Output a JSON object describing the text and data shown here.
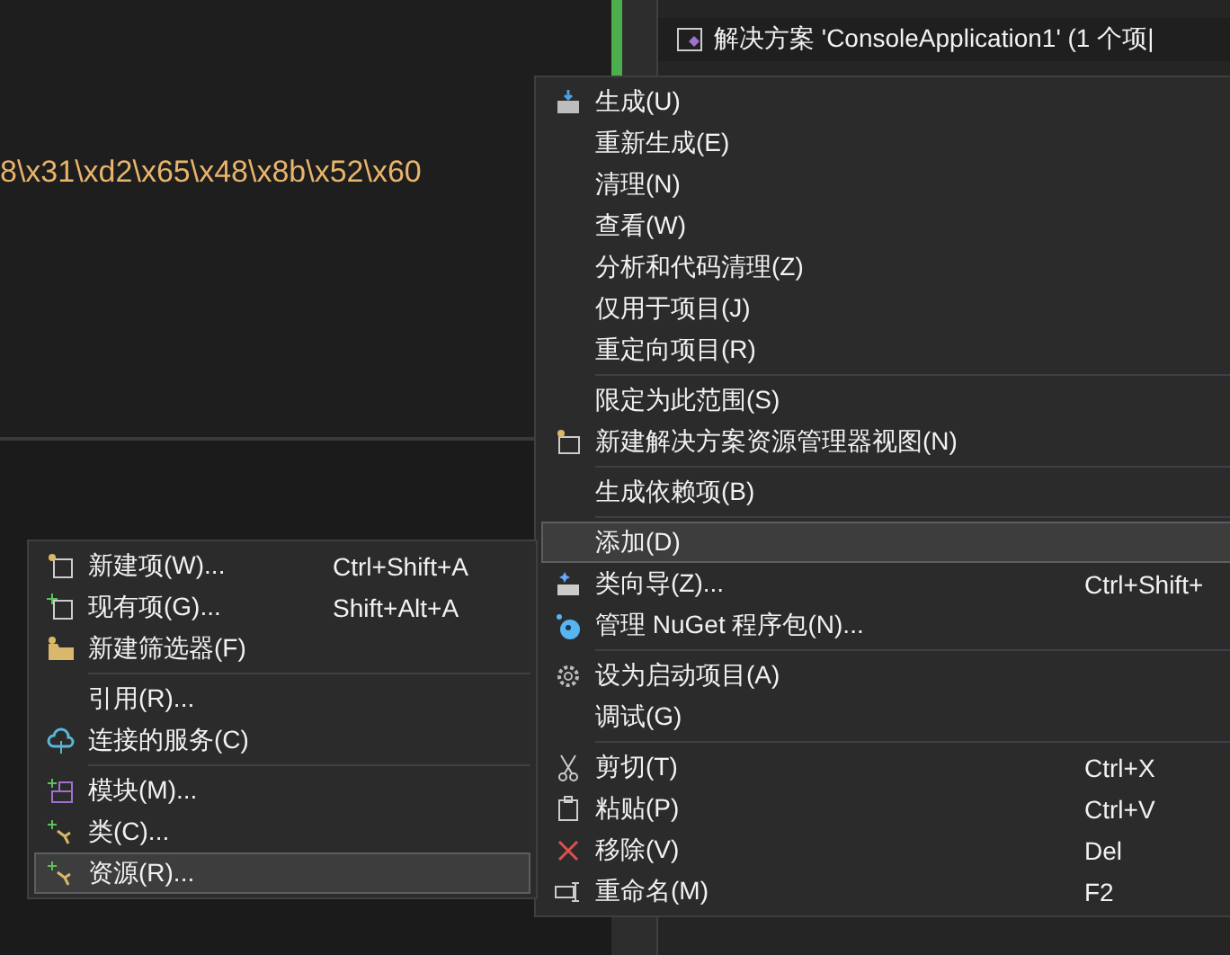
{
  "editor": {
    "code_line": "8\\x31\\xd2\\x65\\x48\\x8b\\x52\\x60"
  },
  "solution_explorer": {
    "solution_row": "解决方案 'ConsoleApplication1' (1 个项|"
  },
  "context_menu": {
    "items": [
      {
        "kind": "item",
        "label": "生成(U)",
        "selected": false
      },
      {
        "kind": "item",
        "label": "重新生成(E)",
        "selected": false
      },
      {
        "kind": "item",
        "label": "清理(N)",
        "selected": false
      },
      {
        "kind": "item",
        "label": "查看(W)",
        "selected": false
      },
      {
        "kind": "item",
        "label": "分析和代码清理(Z)",
        "selected": false
      },
      {
        "kind": "item",
        "label": "仅用于项目(J)",
        "selected": false
      },
      {
        "kind": "item",
        "label": "重定向项目(R)",
        "selected": false
      },
      {
        "kind": "separator"
      },
      {
        "kind": "item",
        "label": "限定为此范围(S)",
        "selected": false
      },
      {
        "kind": "item",
        "label": "新建解决方案资源管理器视图(N)",
        "selected": false
      },
      {
        "kind": "separator"
      },
      {
        "kind": "item",
        "label": "生成依赖项(B)",
        "selected": false
      },
      {
        "kind": "separator"
      },
      {
        "kind": "item",
        "label": "添加(D)",
        "selected": true
      },
      {
        "kind": "item",
        "label": "类向导(Z)...",
        "shortcut": "Ctrl+Shift+",
        "selected": false
      },
      {
        "kind": "item",
        "label": "管理 NuGet 程序包(N)...",
        "selected": false
      },
      {
        "kind": "separator"
      },
      {
        "kind": "item",
        "label": "设为启动项目(A)",
        "selected": false
      },
      {
        "kind": "item",
        "label": "调试(G)",
        "selected": false
      },
      {
        "kind": "separator"
      },
      {
        "kind": "item",
        "label": "剪切(T)",
        "shortcut": "Ctrl+X",
        "selected": false
      },
      {
        "kind": "item",
        "label": "粘贴(P)",
        "shortcut": "Ctrl+V",
        "selected": false
      },
      {
        "kind": "item",
        "label": "移除(V)",
        "shortcut": "Del",
        "selected": false
      },
      {
        "kind": "item",
        "label": "重命名(M)",
        "shortcut": "F2",
        "selected": false
      }
    ]
  },
  "add_submenu": {
    "items": [
      {
        "kind": "item",
        "label": "新建项(W)...",
        "shortcut": "Ctrl+Shift+A",
        "selected": false
      },
      {
        "kind": "item",
        "label": "现有项(G)...",
        "shortcut": "Shift+Alt+A",
        "selected": false
      },
      {
        "kind": "item",
        "label": "新建筛选器(F)",
        "selected": false
      },
      {
        "kind": "separator"
      },
      {
        "kind": "item",
        "label": "引用(R)...",
        "selected": false
      },
      {
        "kind": "item",
        "label": "连接的服务(C)",
        "selected": false
      },
      {
        "kind": "separator"
      },
      {
        "kind": "item",
        "label": "模块(M)...",
        "selected": false
      },
      {
        "kind": "item",
        "label": "类(C)...",
        "selected": false
      },
      {
        "kind": "item",
        "label": "资源(R)...",
        "selected": true
      }
    ]
  }
}
